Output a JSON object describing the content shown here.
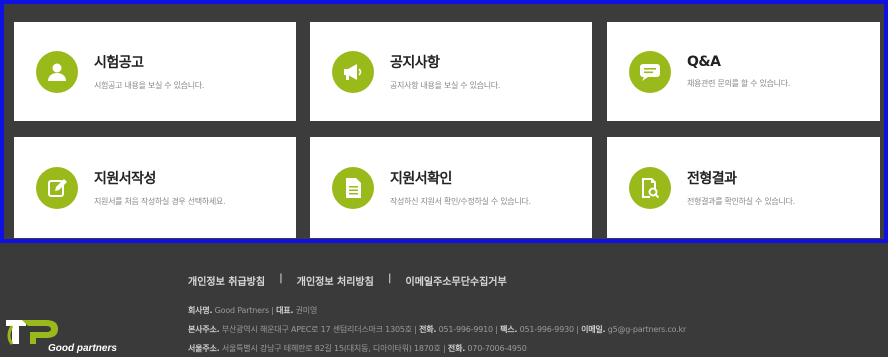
{
  "cards": [
    {
      "title": "시험공고",
      "desc": "시험공고 내용을 보실 수 있습니다.",
      "icon": "user-icon"
    },
    {
      "title": "공지사항",
      "desc": "공지사항 내용을 보실 수 있습니다.",
      "icon": "megaphone-icon"
    },
    {
      "title": "Q&A",
      "desc": "채용관련 문의를 할 수 있습니다.",
      "icon": "chat-icon"
    },
    {
      "title": "지원서작성",
      "desc": "지원서를 처음 작성하실 경우 선택하세요.",
      "icon": "edit-icon"
    },
    {
      "title": "지원서확인",
      "desc": "작성하신 지원서 확인/수정하실 수 있습니다.",
      "icon": "document-icon"
    },
    {
      "title": "전형결과",
      "desc": "전형결과를 확인하실 수 있습니다.",
      "icon": "search-document-icon"
    }
  ],
  "footer": {
    "links": [
      "개인정보 취급방침",
      "개인정보 처리방침",
      "이메일주소무단수집거부"
    ],
    "separator": "|",
    "company_label": "회사명.",
    "company": "Good Partners",
    "ceo_label": "대표.",
    "ceo": "권미영",
    "hq_label": "본사주소.",
    "hq_address": "부산광역시 해운대구 APEC로 17 센텀리더스마크 1305호",
    "tel_label": "전화.",
    "hq_tel": "051-996-9910",
    "fax_label": "팩스.",
    "fax": "051-996-9930",
    "email_label": "이메일.",
    "email": "g5@g-partners.co.kr",
    "seoul_label": "서울주소.",
    "seoul_address": "서울특별시 강남구 테헤란로 82길 15(대치동, 디아이타워) 1870호",
    "seoul_tel": "070-7006-4950",
    "logo_text": "Good partners"
  },
  "colors": {
    "accent": "#9ab91a",
    "highlight_border": "#1010e0",
    "background": "#3a3a3a"
  }
}
